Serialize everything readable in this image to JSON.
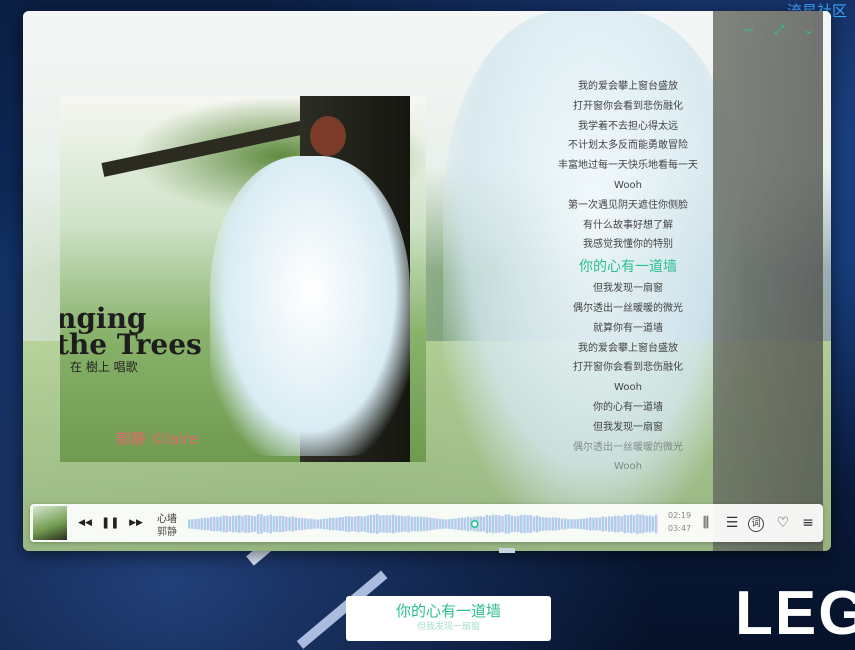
{
  "desktop": {
    "brand_text": "流星社区",
    "logo_text": "LEG",
    "colors": {
      "background": "#0b1f44",
      "accent": "#2bbf8e",
      "brand": "#3da6ff"
    }
  },
  "window": {
    "controls": [
      {
        "name": "minimize",
        "icon": "minus-icon",
        "glyph": "−"
      },
      {
        "name": "maximize",
        "icon": "expand-icon",
        "glyph": "⤢"
      },
      {
        "name": "collapse",
        "icon": "double-chevron-down-icon",
        "glyph": "⌄"
      }
    ]
  },
  "album": {
    "cover_title": "nging\nthe Trees",
    "cover_subtitle": "在 樹上 唱歌",
    "cover_signature": "郭靜 ©laire"
  },
  "lyrics": {
    "lines": [
      "我的爱会攀上窗台盛放",
      "打开窗你会看到悲伤融化",
      "我学着不去担心得太远",
      "不计划太多反而能勇敢冒险",
      "丰富地过每一天快乐地看每一天",
      "Wooh",
      "第一次遇见阴天遮住你侧脸",
      "有什么故事好想了解",
      "我感觉我懂你的特别",
      "你的心有一道墙",
      "但我发现一扇窗",
      "偶尔透出一丝暖暖的微光",
      "就算你有一道墙",
      "我的爱会攀上窗台盛放",
      "打开窗你会看到悲伤融化",
      "Wooh",
      "你的心有一道墙",
      "但我发现一扇窗",
      "偶尔透出一丝暖暖的微光",
      "Wooh"
    ],
    "current_index": 9
  },
  "player": {
    "track_title": "心墙",
    "artist": "郭静",
    "time_current": "02:19",
    "time_total": "03:47",
    "progress": 0.61,
    "buttons": {
      "prev_glyph": "◀◀",
      "pause_glyph": "❚❚",
      "next_glyph": "▶▶",
      "eq_glyph": "⫼",
      "list_glyph": "☰",
      "lyric_glyph": "词",
      "fav_glyph": "♡",
      "menu_glyph": "≡"
    },
    "waveform_colors": {
      "start": "#7fe3e8",
      "end": "#e8b5f0",
      "thumb": "#2bbf8e"
    }
  },
  "desktop_lyric": {
    "current": "你的心有一道墙",
    "next": "但我发现一扇窗"
  }
}
